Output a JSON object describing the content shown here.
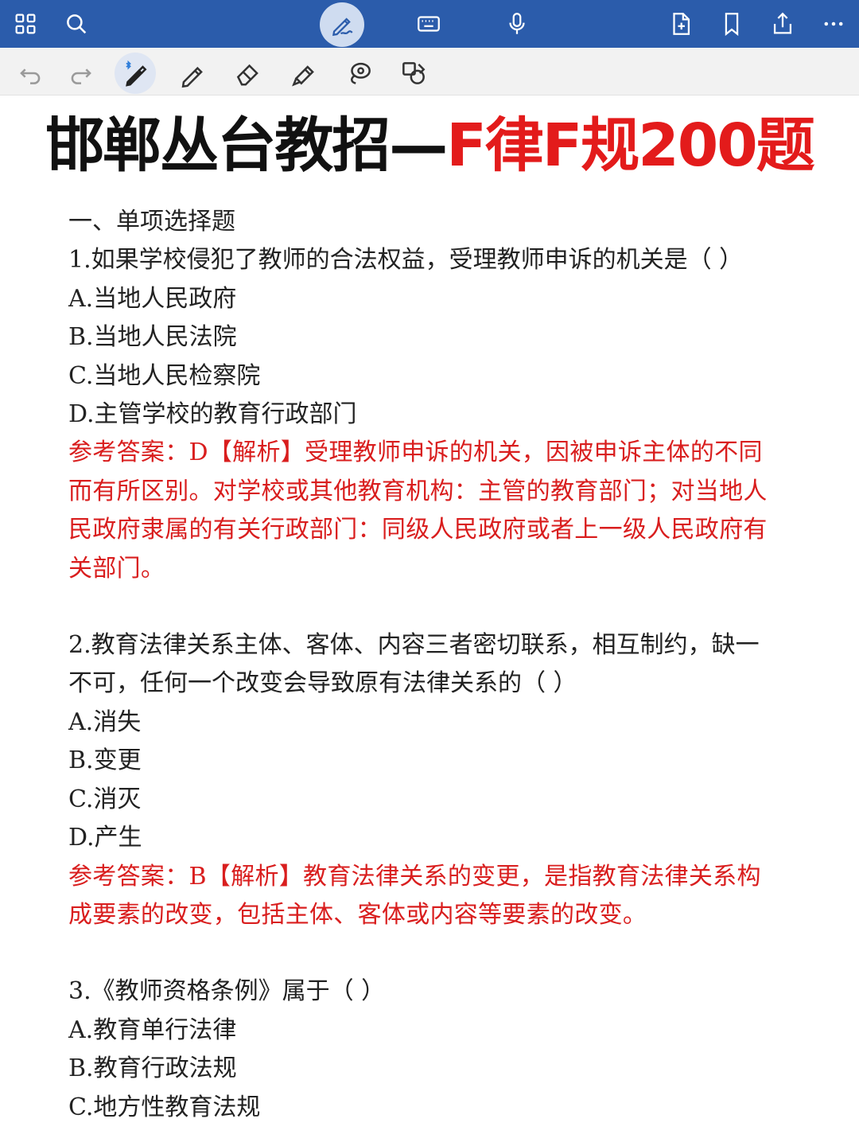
{
  "top_toolbar": {
    "left_icons": [
      "grid-icon",
      "search-icon"
    ],
    "center_icons": [
      "pen-mode-icon",
      "keyboard-icon",
      "microphone-icon"
    ],
    "right_icons": [
      "add-page-icon",
      "bookmark-icon",
      "share-icon",
      "more-icon"
    ],
    "colors": {
      "bar": "#2b5cab",
      "pen_mode_bg": "#cfdcf0"
    }
  },
  "drawing_toolbar": {
    "icons": [
      "undo-icon",
      "redo-icon",
      "bluetooth-pen-icon",
      "pencil-icon",
      "eraser-icon",
      "highlighter-icon",
      "lasso-icon",
      "shapes-icon"
    ]
  },
  "document": {
    "title_black": "邯郸丛台教招—",
    "title_red": "F律F规200题",
    "section": "一、单项选择题",
    "questions": [
      {
        "stem_lines": [
          "1.如果学校侵犯了教师的合法权益，受理教师申诉的机关是（ ）"
        ],
        "options": [
          "A.当地人民政府",
          "B.当地人民法院",
          "C.当地人民检察院",
          "D.主管学校的教育行政部门"
        ],
        "answer_lines": [
          "参考答案：D【解析】受理教师申诉的机关，因被申诉主体的不同",
          "而有所区别。对学校或其他教育机构：主管的教育部门；对当地人",
          "民政府隶属的有关行政部门：同级人民政府或者上一级人民政府有",
          "关部门。"
        ]
      },
      {
        "stem_lines": [
          "2.教育法律关系主体、客体、内容三者密切联系，相互制约，缺一",
          "不可，任何一个改变会导致原有法律关系的（ ）"
        ],
        "options": [
          "A.消失",
          "B.变更",
          "C.消灭",
          "D.产生"
        ],
        "answer_lines": [
          "参考答案：B【解析】教育法律关系的变更，是指教育法律关系构",
          "成要素的改变，包括主体、客体或内容等要素的改变。"
        ]
      },
      {
        "stem_lines": [
          "3.《教师资格条例》属于（ ）"
        ],
        "options": [
          "A.教育单行法律",
          "B.教育行政法规",
          "C.地方性教育法规"
        ],
        "answer_lines": []
      }
    ],
    "colors": {
      "text": "#222222",
      "answer": "#d91e1e",
      "title_red": "#e31b1b"
    }
  }
}
